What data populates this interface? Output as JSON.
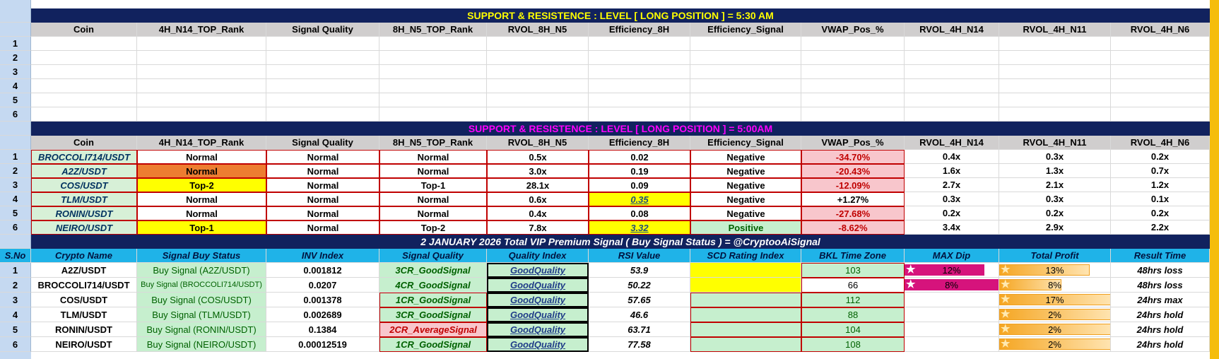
{
  "banner1": "SUPPORT  &  RESISTENCE  :  LEVEL     [   LONG  POSITION  ]       =       5:30 AM",
  "banner2": "SUPPORT  &  RESISTENCE  :  LEVEL     [   LONG   POSITION   ]       =       5:00AM",
  "banner3": "2  JANUARY   2026    Total  VIP Premium Signal  ( Buy Signal Status )    =    @CryptooAiSignal",
  "col_headers": [
    "Coin",
    "4H_N14_TOP_Rank",
    "Signal Quality",
    "8H_N5_TOP_Rank",
    "RVOL_8H_N5",
    "Efficiency_8H",
    "Efficiency_Signal",
    "VWAP_Pos_%",
    "RVOL_4H_N14",
    "RVOL_4H_N11",
    "RVOL_4H_N6"
  ],
  "empty_row_numbers": [
    "1",
    "2",
    "3",
    "4",
    "5",
    "6"
  ],
  "table2": [
    {
      "n": "1",
      "coin": "BROCCOLI714/USDT",
      "rank4h": "Normal",
      "quality": "Normal",
      "rank8h": "Normal",
      "rvol8h": "0.5x",
      "eff8h": "0.02",
      "effsig": "Negative",
      "vwap": "-34.70%",
      "r14": "0.4x",
      "r11": "0.3x",
      "r6": "0.2x"
    },
    {
      "n": "2",
      "coin": "A2Z/USDT",
      "rank4h": "Normal",
      "quality": "Normal",
      "rank8h": "Normal",
      "rvol8h": "3.0x",
      "eff8h": "0.19",
      "effsig": "Negative",
      "vwap": "-20.43%",
      "r14": "1.6x",
      "r11": "1.3x",
      "r6": "0.7x"
    },
    {
      "n": "3",
      "coin": "COS/USDT",
      "rank4h": "Top-2",
      "quality": "Normal",
      "rank8h": "Top-1",
      "rvol8h": "28.1x",
      "eff8h": "0.09",
      "effsig": "Negative",
      "vwap": "-12.09%",
      "r14": "2.7x",
      "r11": "2.1x",
      "r6": "1.2x"
    },
    {
      "n": "4",
      "coin": "TLM/USDT",
      "rank4h": "Normal",
      "quality": "Normal",
      "rank8h": "Normal",
      "rvol8h": "0.6x",
      "eff8h": "0.35",
      "effsig": "Negative",
      "vwap": "+1.27%",
      "r14": "0.3x",
      "r11": "0.3x",
      "r6": "0.1x"
    },
    {
      "n": "5",
      "coin": "RONIN/USDT",
      "rank4h": "Normal",
      "quality": "Normal",
      "rank8h": "Normal",
      "rvol8h": "0.4x",
      "eff8h": "0.08",
      "effsig": "Negative",
      "vwap": "-27.68%",
      "r14": "0.2x",
      "r11": "0.2x",
      "r6": "0.2x"
    },
    {
      "n": "6",
      "coin": "NEIRO/USDT",
      "rank4h": "Top-1",
      "quality": "Normal",
      "rank8h": "Top-2",
      "rvol8h": "7.8x",
      "eff8h": "3.32",
      "effsig": "Positive",
      "vwap": "-8.62%",
      "r14": "3.4x",
      "r11": "2.9x",
      "r6": "2.2x"
    }
  ],
  "signal_headers": [
    "S.No",
    "Crypto Name",
    "Signal Buy Status",
    "INV  Index",
    "Signal Quality",
    "Quality Index",
    "RSI Value",
    "SCD  Rating Index",
    "BKL Time Zone",
    "MAX Dip",
    "Total Profit",
    "Result Time"
  ],
  "signals": [
    {
      "n": "1",
      "name": "A2Z/USDT",
      "status": "Buy Signal (A2Z/USDT)",
      "inv": "0.001812",
      "quality": "3CR_GoodSignal",
      "qindex": "GoodQuality",
      "rsi": "53.9",
      "bkl": "103",
      "dip": "12%",
      "dip_frac": 0.85,
      "profit": "13%",
      "profit_frac": 0.8,
      "result": "48hrs loss"
    },
    {
      "n": "2",
      "name": "BROCCOLI714/USDT",
      "status": "Buy Signal (BROCCOLI714/USDT)",
      "inv": "0.0207",
      "quality": "4CR_GoodSignal",
      "qindex": "GoodQuality",
      "rsi": "50.22",
      "bkl": "66",
      "dip": "8%",
      "dip_frac": 1.0,
      "profit": "8%",
      "profit_frac": 0.55,
      "result": "48hrs loss"
    },
    {
      "n": "3",
      "name": "COS/USDT",
      "status": "Buy Signal (COS/USDT)",
      "inv": "0.001378",
      "quality": "1CR_GoodSignal",
      "qindex": "GoodQuality",
      "rsi": "57.65",
      "bkl": "112",
      "dip": "",
      "dip_frac": 0,
      "profit": "17%",
      "profit_frac": 1.0,
      "result": "24hrs max"
    },
    {
      "n": "4",
      "name": "TLM/USDT",
      "status": "Buy Signal (TLM/USDT)",
      "inv": "0.002689",
      "quality": "3CR_GoodSignal",
      "qindex": "GoodQuality",
      "rsi": "46.6",
      "bkl": "88",
      "dip": "",
      "dip_frac": 0,
      "profit": "2%",
      "profit_frac": 1.0,
      "result": "24hrs hold"
    },
    {
      "n": "5",
      "name": "RONIN/USDT",
      "status": "Buy Signal (RONIN/USDT)",
      "inv": "0.1384",
      "quality": "2CR_AverageSignal",
      "qindex": "GoodQuality",
      "rsi": "63.71",
      "bkl": "104",
      "dip": "",
      "dip_frac": 0,
      "profit": "2%",
      "profit_frac": 1.0,
      "result": "24hrs hold"
    },
    {
      "n": "6",
      "name": "NEIRO/USDT",
      "status": "Buy Signal (NEIRO/USDT)",
      "inv": "0.00012519",
      "quality": "1CR_GoodSignal",
      "qindex": "GoodQuality",
      "rsi": "77.58",
      "bkl": "108",
      "dip": "",
      "dip_frac": 0,
      "profit": "2%",
      "profit_frac": 1.0,
      "result": "24hrs hold"
    }
  ],
  "star_glyph": "★"
}
